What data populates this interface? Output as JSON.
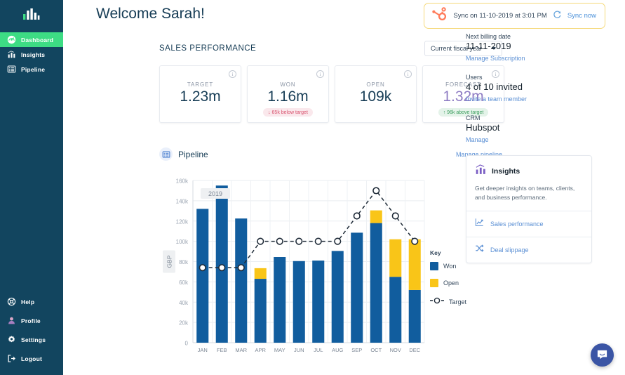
{
  "sidebar": {
    "logo_icon": "bar-chart-logo",
    "top_items": [
      {
        "label": "Dashboard",
        "icon": "gauge-icon",
        "active": true
      },
      {
        "label": "Insights",
        "icon": "bar-chart-icon",
        "active": false
      },
      {
        "label": "Pipeline",
        "icon": "list-table-icon",
        "active": false
      }
    ],
    "bottom_items": [
      {
        "label": "Help",
        "icon": "life-ring-icon"
      },
      {
        "label": "Profile",
        "icon": "avatar-icon"
      },
      {
        "label": "Settings",
        "icon": "gear-icon"
      },
      {
        "label": "Logout",
        "icon": "logout-icon"
      }
    ]
  },
  "header": {
    "title": "Welcome Sarah!",
    "sync": {
      "icon": "hubspot-sprocket-icon",
      "text": "Sync on 11-10-2019 at 3:01 PM",
      "refresh_icon": "refresh-icon",
      "action_label": "Sync now",
      "border_color": "#f5d97a"
    }
  },
  "sales_performance": {
    "section_title": "SALES PERFORMANCE",
    "fiscal_select": {
      "value": "Current fiscal year",
      "icon": "chevron-down-icon"
    },
    "cards": [
      {
        "label": "TARGET",
        "value": "1.23m",
        "badge": null,
        "badge_dir": null,
        "accent": "#163c55",
        "info_icon": "info-icon"
      },
      {
        "label": "WON",
        "value": "1.16m",
        "badge": "65k below target",
        "badge_dir": "down",
        "accent": "#163c55",
        "info_icon": "info-icon"
      },
      {
        "label": "OPEN",
        "value": "109k",
        "badge": null,
        "badge_dir": null,
        "accent": "#163c55",
        "info_icon": "info-icon"
      },
      {
        "label": "FORECAST",
        "value": "1.32m",
        "badge": "96k above target",
        "badge_dir": "up",
        "accent": "#8e7cc3",
        "info_icon": "info-icon"
      }
    ]
  },
  "pipeline": {
    "icon": "list-table-icon",
    "title": "Pipeline",
    "manage_label": "Manage pipeline",
    "year_label": "2019"
  },
  "chart_data": {
    "type": "bar",
    "title": "Pipeline",
    "xlabel": "2019",
    "ylabel": "GBP",
    "ylim": [
      0,
      160000
    ],
    "ytick_labels": [
      "0",
      "20k",
      "40k",
      "60k",
      "80k",
      "100k",
      "120k",
      "140k",
      "160k"
    ],
    "ytick_values": [
      0,
      20000,
      40000,
      60000,
      80000,
      100000,
      120000,
      140000,
      160000
    ],
    "grid": true,
    "stacked": true,
    "categories": [
      "JAN",
      "FEB",
      "MAR",
      "APR",
      "MAY",
      "JUN",
      "JUL",
      "AUG",
      "SEP",
      "OCT",
      "NOV",
      "DEC"
    ],
    "series": [
      {
        "name": "Won",
        "color": "#115d9e",
        "values": [
          132000,
          155000,
          122500,
          63000,
          84500,
          80500,
          81000,
          90500,
          108500,
          118000,
          65000,
          52000
        ]
      },
      {
        "name": "Open",
        "color": "#f9c518",
        "values": [
          0,
          0,
          0,
          10500,
          0,
          0,
          0,
          0,
          0,
          12500,
          37000,
          50000
        ]
      }
    ],
    "target_line": {
      "name": "Target",
      "color": "#1f2b38",
      "style": "dashed",
      "values": [
        74000,
        74000,
        74000,
        100000,
        100000,
        100000,
        100000,
        100000,
        125000,
        150000,
        125000,
        100000
      ],
      "filled_markers": [
        true,
        true,
        true,
        false,
        false,
        false,
        false,
        false,
        false,
        false,
        false,
        false
      ]
    },
    "legend": {
      "title": "Key",
      "position": "right",
      "entries": [
        {
          "label": "Won",
          "color": "#115d9e",
          "marker": "square"
        },
        {
          "label": "Open",
          "color": "#f9c518",
          "marker": "square"
        },
        {
          "label": "Target",
          "color": "#1f2b38",
          "marker": "dashed-circle"
        }
      ]
    }
  },
  "right_panel": {
    "groups": [
      {
        "label": "Next billing date",
        "value": "11-11-2019",
        "link": "Manage Subscription"
      },
      {
        "label": "Users",
        "value": "4 of 10 invited",
        "link": "Invite a team member"
      },
      {
        "label": "CRM",
        "value": "Hubspot",
        "link": "Manage"
      }
    ],
    "insights_card": {
      "icon": "insights-bar-chart-icon",
      "title": "Insights",
      "description": "Get deeper insights on teams, clients, and business performance.",
      "rows": [
        {
          "label": "Sales performance",
          "icon": "line-chart-icon"
        },
        {
          "label": "Deal slippage",
          "icon": "shuffle-icon"
        }
      ]
    }
  },
  "chat_launcher": {
    "icon": "chat-bubble-icon",
    "color": "#3b55a5"
  }
}
